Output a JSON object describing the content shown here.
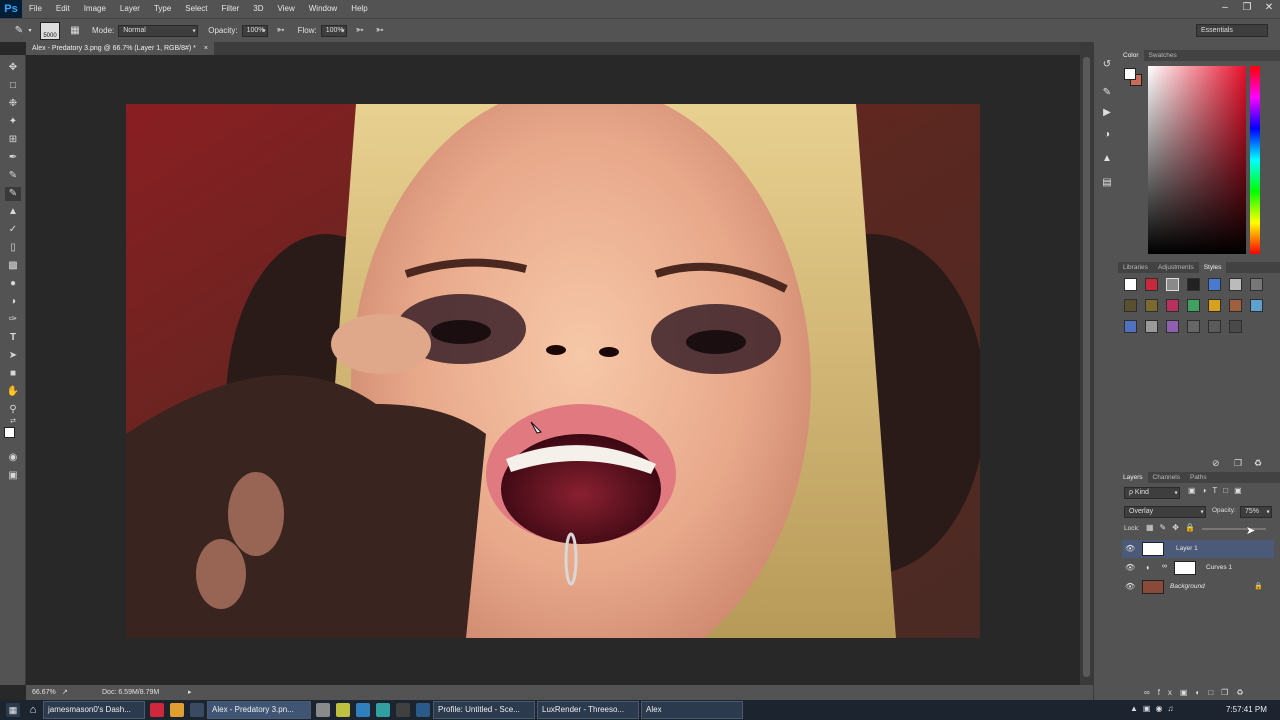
{
  "app": {
    "logo": "Ps"
  },
  "menu": [
    "File",
    "Edit",
    "Image",
    "Layer",
    "Type",
    "Select",
    "Filter",
    "3D",
    "View",
    "Window",
    "Help"
  ],
  "options": {
    "brush_size": "5000",
    "mode_label": "Mode:",
    "mode_value": "Normal",
    "opacity_label": "Opacity:",
    "opacity_value": "100%",
    "flow_label": "Flow:",
    "flow_value": "100%",
    "workspace": "Essentials"
  },
  "document": {
    "tab_title": "Alex - Predatory 3.png @ 66.7% (Layer 1, RGB/8#) *",
    "close": "×"
  },
  "status": {
    "zoom": "66.67%",
    "doc_info": "Doc: 6.59M/8.79M"
  },
  "color_panel": {
    "tabs": [
      "Color",
      "Swatches"
    ]
  },
  "styles_panel": {
    "tabs": [
      "Libraries",
      "Adjustments",
      "Styles"
    ]
  },
  "layers_panel": {
    "tabs": [
      "Layers",
      "Channels",
      "Paths"
    ],
    "kind_filter": "ρ Kind",
    "blend_mode": "Overlay",
    "opacity_label": "Opacity:",
    "opacity_value": "75%",
    "lock_label": "Lock:",
    "layers": [
      {
        "name": "Layer 1",
        "selected": true
      },
      {
        "name": "Curves 1",
        "selected": false
      },
      {
        "name": "Background",
        "selected": false
      }
    ]
  },
  "taskbar": {
    "items": [
      {
        "label": "jamesmason0's Dash...",
        "active": false
      },
      {
        "label": "Alex - Predatory 3.pn...",
        "active": true
      },
      {
        "label": "Profile: Untitled - Sce...",
        "active": false
      },
      {
        "label": "LuxRender - Threeso...",
        "active": false
      },
      {
        "label": "Alex",
        "active": false
      }
    ],
    "clock": "7:57:41 PM"
  },
  "colors": {
    "ui_dark": "#282828",
    "panel": "#535353",
    "ps_blue": "#31a8ff"
  }
}
